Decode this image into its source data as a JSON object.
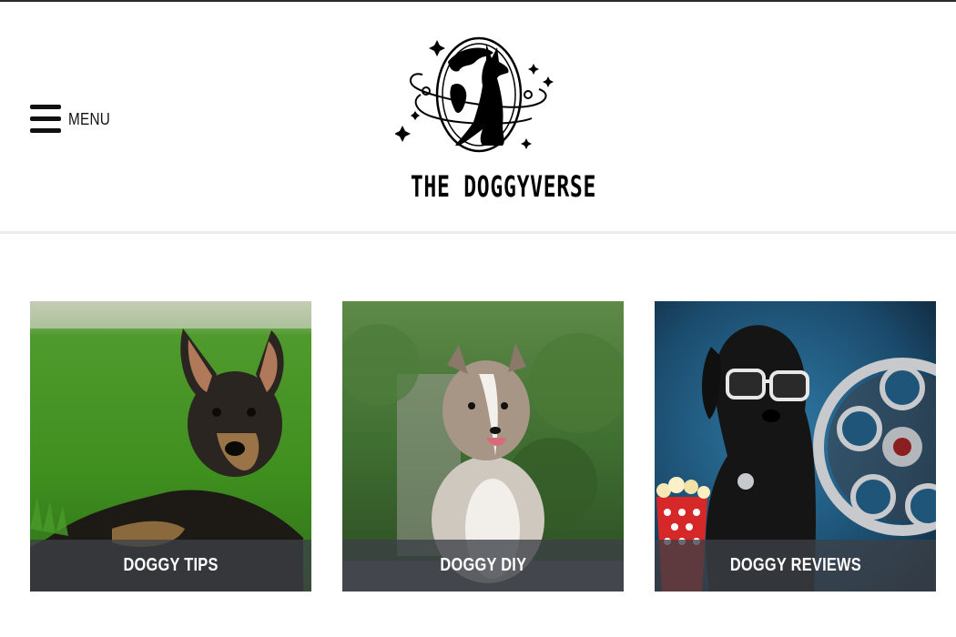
{
  "header": {
    "menu_label": "MENU",
    "site_name": "THE DOGGYVERSE"
  },
  "icons": {
    "menu": "hamburger-icon",
    "logo": "dog-planet-logo"
  },
  "categories": [
    {
      "label": "DOGGY TIPS",
      "image": "german-shepherd-puppy-on-grass"
    },
    {
      "label": "DOGGY DIY",
      "image": "sheltie-puppy-in-garden"
    },
    {
      "label": "DOGGY REVIEWS",
      "image": "black-dog-with-sunglasses-film-reel-popcorn"
    }
  ],
  "colors": {
    "caption_overlay": "#3c4046",
    "text_primary": "#111111",
    "header_border": "#ececec"
  }
}
